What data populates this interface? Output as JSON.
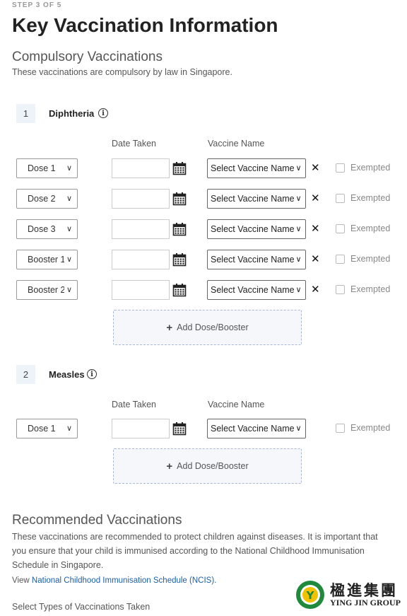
{
  "step_label": "STEP 3 OF 5",
  "page_title": "Key Vaccination Information",
  "compulsory": {
    "title": "Compulsory Vaccinations",
    "description": "These vaccinations are compulsory by law in Singapore.",
    "columns": {
      "date": "Date Taken",
      "vaccine": "Vaccine Name"
    },
    "vaccines": [
      {
        "number": "1",
        "name": "Diphtheria",
        "doses": [
          {
            "dose": "Dose 1",
            "date": "",
            "vaccine": "Select Vaccine Name",
            "exempted_label": "Exempted",
            "removable": true
          },
          {
            "dose": "Dose 2",
            "date": "",
            "vaccine": "Select Vaccine Name",
            "exempted_label": "Exempted",
            "removable": true
          },
          {
            "dose": "Dose 3",
            "date": "",
            "vaccine": "Select Vaccine Name",
            "exempted_label": "Exempted",
            "removable": true
          },
          {
            "dose": "Booster 1",
            "date": "",
            "vaccine": "Select Vaccine Name",
            "exempted_label": "Exempted",
            "removable": true
          },
          {
            "dose": "Booster 2",
            "date": "",
            "vaccine": "Select Vaccine Name",
            "exempted_label": "Exempted",
            "removable": true
          }
        ],
        "add_label": "Add Dose/Booster"
      },
      {
        "number": "2",
        "name": "Measles",
        "doses": [
          {
            "dose": "Dose 1",
            "date": "",
            "vaccine": "Select Vaccine Name",
            "exempted_label": "Exempted",
            "removable": false
          }
        ],
        "add_label": "Add Dose/Booster"
      }
    ]
  },
  "recommended": {
    "title": "Recommended Vaccinations",
    "description": "These vaccinations are recommended to protect children against diseases. It is important that you ensure that your child is immunised according to the National Childhood Immunisation Schedule in Singapore.",
    "link_prefix": "View ",
    "link_text": "National Childhood Immunisation Schedule (NCIS).",
    "types_label": "Select Types of Vaccinations Taken"
  },
  "watermark": {
    "chinese": "楹進集團",
    "english": "YING JIN GROUP"
  },
  "colors": {
    "link": "#1a5fa8",
    "number_badge": "#eef3fa",
    "logo_green": "#1f8a3c",
    "logo_yellow": "#f2c200"
  }
}
